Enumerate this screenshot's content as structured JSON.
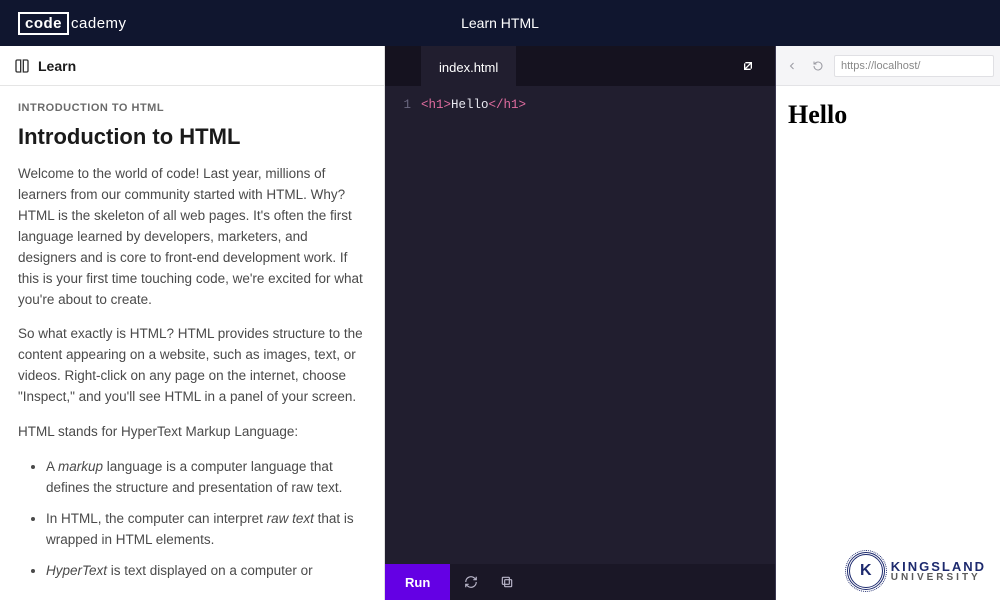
{
  "header": {
    "logo_boxed": "code",
    "logo_rest": "cademy",
    "course_title": "Learn HTML"
  },
  "lesson": {
    "tab_label": "Learn",
    "eyebrow": "INTRODUCTION TO HTML",
    "title": "Introduction to HTML",
    "para1": "Welcome to the world of code! Last year, millions of learners from our community started with HTML. Why? HTML is the skeleton of all web pages. It's often the first language learned by developers, marketers, and designers and is core to front-end development work. If this is your first time touching code, we're excited for what you're about to create.",
    "para2": "So what exactly is HTML? HTML provides structure to the content appearing on a website, such as images, text, or videos. Right-click on any page on the internet, choose \"Inspect,\" and you'll see HTML in a panel of your screen.",
    "para3": "HTML stands for HyperText Markup Language:",
    "bullets": {
      "b1_pre": "A ",
      "b1_em": "markup",
      "b1_post": " language is a computer language that defines the structure and presentation of raw text.",
      "b2_pre": "In HTML, the computer can interpret ",
      "b2_em": "raw text",
      "b2_post": " that is wrapped in HTML elements.",
      "b3_em": "HyperText",
      "b3_post": " is text displayed on a computer or"
    }
  },
  "editor": {
    "tab_filename": "index.html",
    "line_number": "1",
    "code_open": "<h1>",
    "code_text": "Hello",
    "code_close": "</h1>",
    "run_label": "Run"
  },
  "preview": {
    "url": "https://localhost/",
    "output_text": "Hello"
  },
  "watermark": {
    "letter": "K",
    "line1": "KINGSLAND",
    "line2": "UNIVERSITY"
  }
}
